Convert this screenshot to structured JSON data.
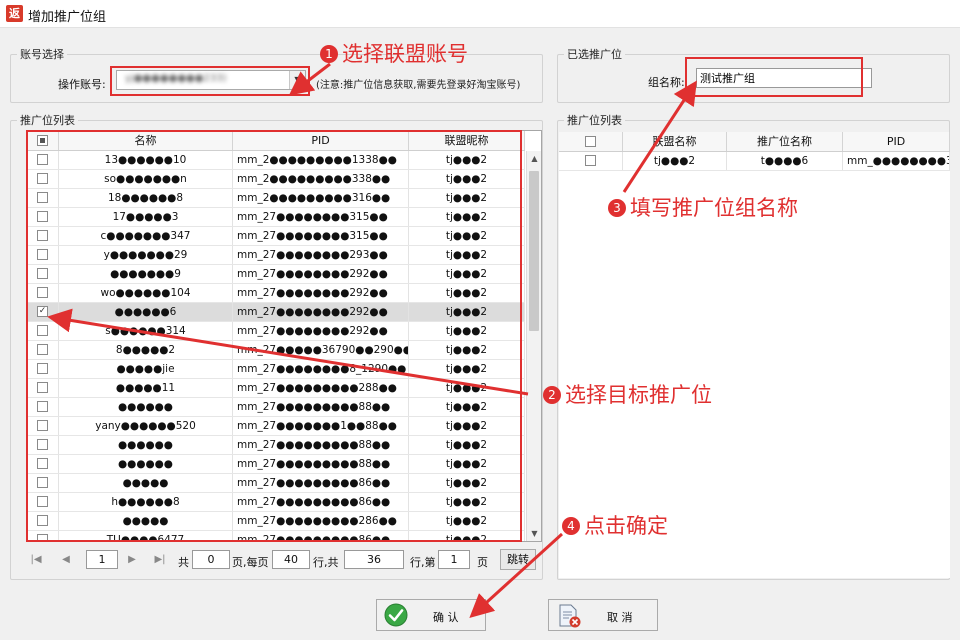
{
  "window": {
    "icon_glyph": "返",
    "title": "增加推广位组"
  },
  "account_group": {
    "legend": "账号选择",
    "account_label": "操作账号:",
    "account_value": "yj●●●●●●●●233)",
    "note": "(注意:推广位信息获取,需要先登录好淘宝账号)"
  },
  "selected_group": {
    "legend": "已选推广位",
    "name_label": "组名称:",
    "name_value": "测试推广组"
  },
  "list_group": {
    "legend": "推广位列表",
    "columns": [
      "名称",
      "PID",
      "联盟昵称"
    ],
    "rows": [
      {
        "name": "13●●●●●●10",
        "pid": "mm_2●●●●●●●●●1338●●",
        "nick": "tj●●●2",
        "checked": false
      },
      {
        "name": "so●●●●●●●n",
        "pid": "mm_2●●●●●●●●●338●●",
        "nick": "tj●●●2",
        "checked": false
      },
      {
        "name": "18●●●●●●8",
        "pid": "mm_2●●●●●●●●●316●●",
        "nick": "tj●●●2",
        "checked": false
      },
      {
        "name": "17●●●●●3",
        "pid": "mm_27●●●●●●●●315●●",
        "nick": "tj●●●2",
        "checked": false
      },
      {
        "name": "c●●●●●●●347",
        "pid": "mm_27●●●●●●●●315●●",
        "nick": "tj●●●2",
        "checked": false
      },
      {
        "name": "y●●●●●●●29",
        "pid": "mm_27●●●●●●●●293●●",
        "nick": "tj●●●2",
        "checked": false
      },
      {
        "name": "●●●●●●●9",
        "pid": "mm_27●●●●●●●●292●●",
        "nick": "tj●●●2",
        "checked": false
      },
      {
        "name": "wo●●●●●●104",
        "pid": "mm_27●●●●●●●●292●●",
        "nick": "tj●●●2",
        "checked": false
      },
      {
        "name": "●●●●●●6",
        "pid": "mm_27●●●●●●●●292●●",
        "nick": "tj●●●2",
        "checked": true
      },
      {
        "name": "s●●●●●●314",
        "pid": "mm_27●●●●●●●●292●●",
        "nick": "tj●●●2",
        "checked": false
      },
      {
        "name": "8●●●●●2",
        "pid": "mm_27●●●●●36790●●290●●",
        "nick": "tj●●●2",
        "checked": false
      },
      {
        "name": "●●●●●jie",
        "pid": "mm_27●●●●●●●●8_1290●●",
        "nick": "tj●●●2",
        "checked": false
      },
      {
        "name": "●●●●●11",
        "pid": "mm_27●●●●●●●●●288●●",
        "nick": "tj●●●2",
        "checked": false
      },
      {
        "name": "●●●●●●",
        "pid": "mm_27●●●●●●●●●88●●",
        "nick": "tj●●●2",
        "checked": false
      },
      {
        "name": "yany●●●●●●520",
        "pid": "mm_27●●●●●●●1●●88●●",
        "nick": "tj●●●2",
        "checked": false
      },
      {
        "name": "●●●●●●",
        "pid": "mm_27●●●●●●●●●88●●",
        "nick": "tj●●●2",
        "checked": false
      },
      {
        "name": "●●●●●●",
        "pid": "mm_27●●●●●●●●●88●●",
        "nick": "tj●●●2",
        "checked": false
      },
      {
        "name": "●●●●●",
        "pid": "mm_27●●●●●●●●●86●●",
        "nick": "tj●●●2",
        "checked": false
      },
      {
        "name": "h●●●●●●8",
        "pid": "mm_27●●●●●●●●●86●●",
        "nick": "tj●●●2",
        "checked": false
      },
      {
        "name": "●●●●●",
        "pid": "mm_27●●●●●●●●●286●●",
        "nick": "tj●●●2",
        "checked": false
      },
      {
        "name": "TU●●●●6477",
        "pid": "mm_27●●●●●●●●●86●●",
        "nick": "tj●●●2",
        "checked": false
      }
    ]
  },
  "pager": {
    "first": "|◀",
    "prev": "◀",
    "next": "▶",
    "last": "▶|",
    "current_page": "1",
    "total_label": "共",
    "total_pages": "0",
    "per_page_label": "页,每页",
    "per_page": "40",
    "rows_label": "行,共",
    "total_rows": "36",
    "row_no_label": "行,第",
    "goto_page": "1",
    "page_unit": "页",
    "jump": "跳转"
  },
  "selected_list": {
    "legend": "推广位列表",
    "columns": [
      "联盟名称",
      "推广位名称",
      "PID"
    ],
    "rows": [
      {
        "union": "tj●●●2",
        "name": "t●●●●6",
        "pid": "mm_●●●●●●●●3"
      }
    ]
  },
  "buttons": {
    "confirm": "确 认",
    "cancel": "取 消"
  },
  "annotations": {
    "a1": {
      "num": "1",
      "text": "选择联盟账号"
    },
    "a2": {
      "num": "2",
      "text": "选择目标推广位"
    },
    "a3": {
      "num": "3",
      "text": "填写推广位组名称"
    },
    "a4": {
      "num": "4",
      "text": "点击确定"
    }
  },
  "colors": {
    "annotation": "#e03030",
    "confirm_icon": "#3aa845",
    "cancel_icon": "#d23c2c"
  }
}
